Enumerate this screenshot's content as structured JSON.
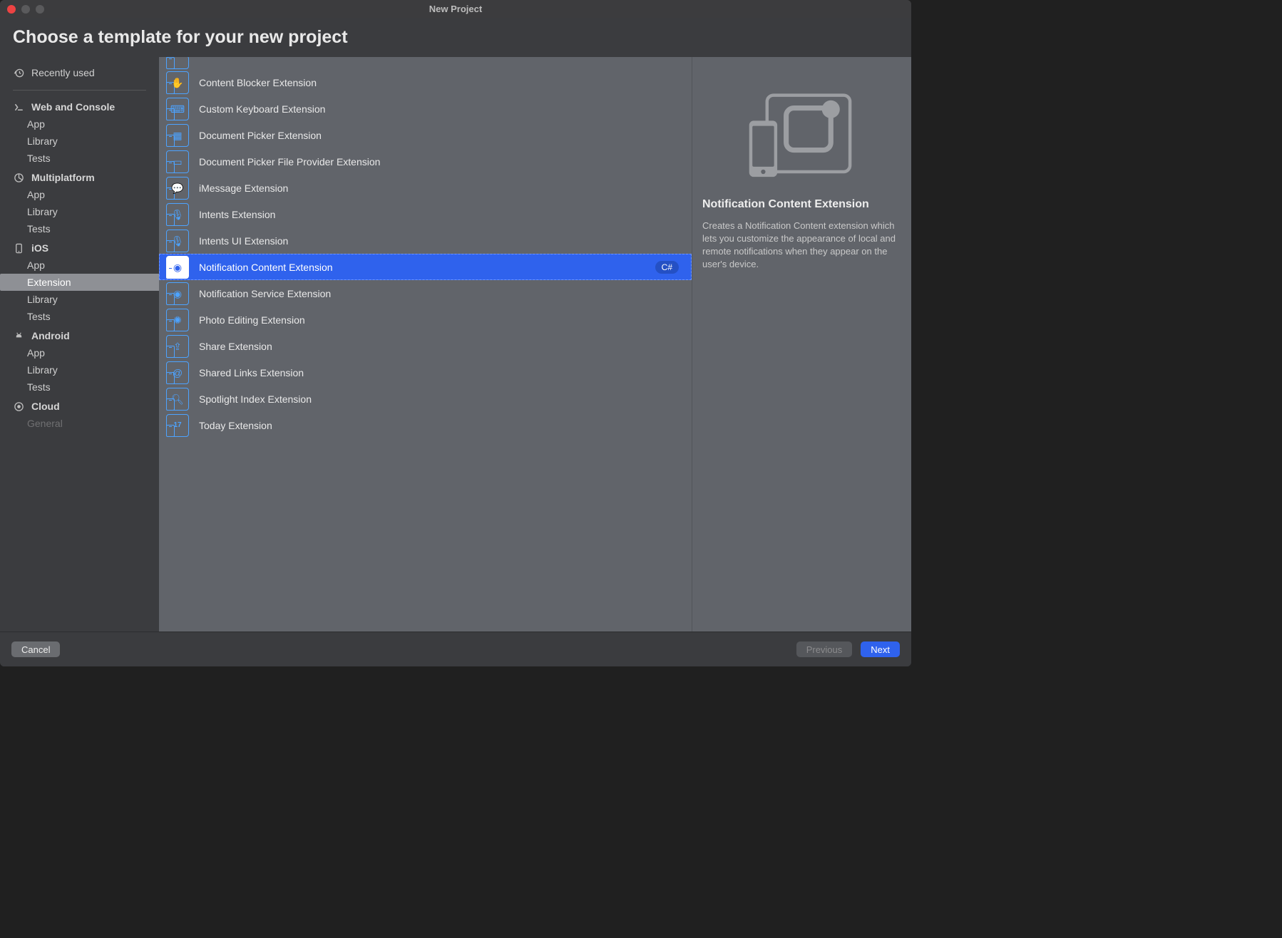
{
  "window": {
    "title": "New Project"
  },
  "header": {
    "title": "Choose a template for your new project"
  },
  "sidebar": {
    "recent_label": "Recently used",
    "sections": [
      {
        "title": "Web and Console",
        "icon": "terminal-icon",
        "items": [
          {
            "label": "App"
          },
          {
            "label": "Library"
          },
          {
            "label": "Tests"
          }
        ]
      },
      {
        "title": "Multiplatform",
        "icon": "pie-icon",
        "items": [
          {
            "label": "App"
          },
          {
            "label": "Library"
          },
          {
            "label": "Tests"
          }
        ]
      },
      {
        "title": "iOS",
        "icon": "phone-icon",
        "items": [
          {
            "label": "App"
          },
          {
            "label": "Extension",
            "selected": true
          },
          {
            "label": "Library"
          },
          {
            "label": "Tests"
          }
        ]
      },
      {
        "title": "Android",
        "icon": "android-icon",
        "items": [
          {
            "label": "App"
          },
          {
            "label": "Library"
          },
          {
            "label": "Tests"
          }
        ]
      },
      {
        "title": "Cloud",
        "icon": "target-icon",
        "items": [
          {
            "label": "General"
          }
        ]
      }
    ]
  },
  "templates": [
    {
      "label": "Content Blocker Extension"
    },
    {
      "label": "Custom Keyboard Extension"
    },
    {
      "label": "Document Picker Extension"
    },
    {
      "label": "Document Picker File Provider Extension"
    },
    {
      "label": "iMessage Extension"
    },
    {
      "label": "Intents Extension"
    },
    {
      "label": "Intents UI Extension"
    },
    {
      "label": "Notification Content Extension",
      "selected": true,
      "badge": "C#"
    },
    {
      "label": "Notification Service Extension"
    },
    {
      "label": "Photo Editing Extension"
    },
    {
      "label": "Share Extension"
    },
    {
      "label": "Shared Links Extension"
    },
    {
      "label": "Spotlight Index Extension"
    },
    {
      "label": "Today Extension"
    }
  ],
  "detail": {
    "title": "Notification Content Extension",
    "description": "Creates a Notification Content extension which lets you customize the appearance of local and remote notifications when they appear on the user's device."
  },
  "footer": {
    "cancel": "Cancel",
    "previous": "Previous",
    "next": "Next"
  }
}
